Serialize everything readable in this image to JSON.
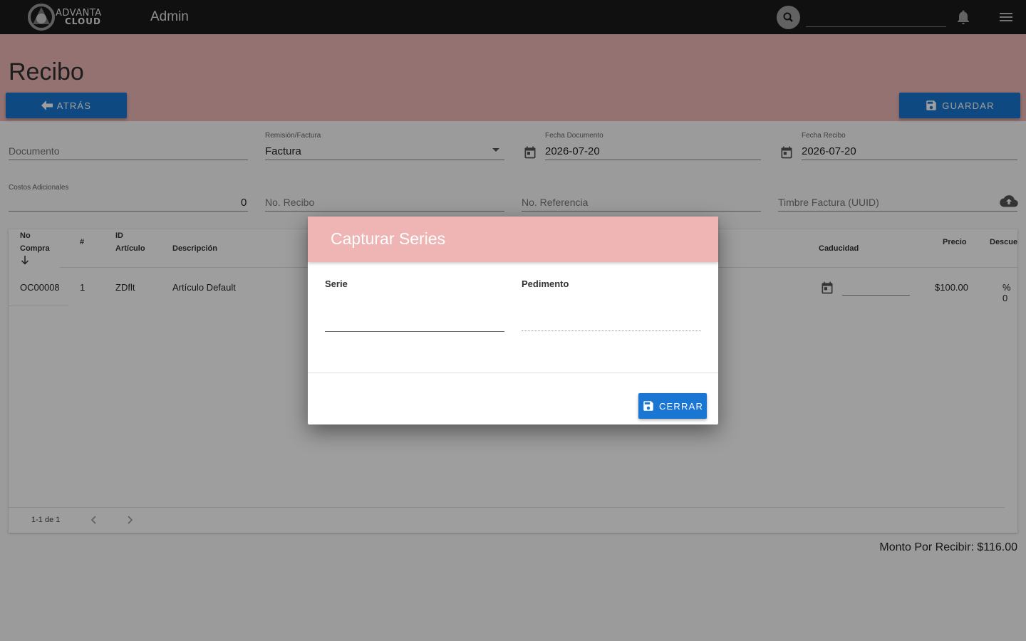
{
  "topbar": {
    "logo_line1": "ADVANTA",
    "logo_line2": "CLOUD",
    "app_title": "Admin",
    "search_value": ""
  },
  "header": {
    "page_title": "Recibo",
    "back_label": "ATRÁS",
    "save_label": "GUARDAR"
  },
  "form": {
    "documento_placeholder": "Documento",
    "remision_label": "Remisión/Factura",
    "remision_value": "Factura",
    "fecha_documento_label": "Fecha Documento",
    "fecha_documento_value": "2026-07-20",
    "fecha_recibo_label": "Fecha Recibo",
    "fecha_recibo_value": "2026-07-20",
    "costos_label": "Costos Adicionales",
    "costos_value": "0",
    "no_recibo_placeholder": "No. Recibo",
    "no_referencia_placeholder": "No. Referencia",
    "timbre_placeholder": "Timbre Factura (UUID)"
  },
  "table": {
    "headers": {
      "no_compra_1": "No",
      "no_compra_2": "Compra",
      "num": "#",
      "id_articulo_1": "ID",
      "id_articulo_2": "Artículo",
      "descripcion": "Descripción",
      "caducidad": "Caducidad",
      "precio": "Precio",
      "descuento": "Descue"
    },
    "rows": [
      {
        "no_compra": "OC00008",
        "num": "1",
        "id_articulo": "ZDflt",
        "descripcion": "Artículo Default",
        "precio": "$100.00",
        "descuento": "% 0"
      }
    ],
    "pagination": "1-1 de 1"
  },
  "total_label": "Monto Por Recibir: $116.00",
  "dialog": {
    "title": "Capturar Series",
    "serie_label": "Serie",
    "pedimento_label": "Pedimento",
    "close_label": "CERRAR"
  },
  "colors": {
    "topbar": "#1b1b1b",
    "header_band": "#efb8b8",
    "primary": "#1976d2",
    "dialog_header": "#efb4b4"
  }
}
